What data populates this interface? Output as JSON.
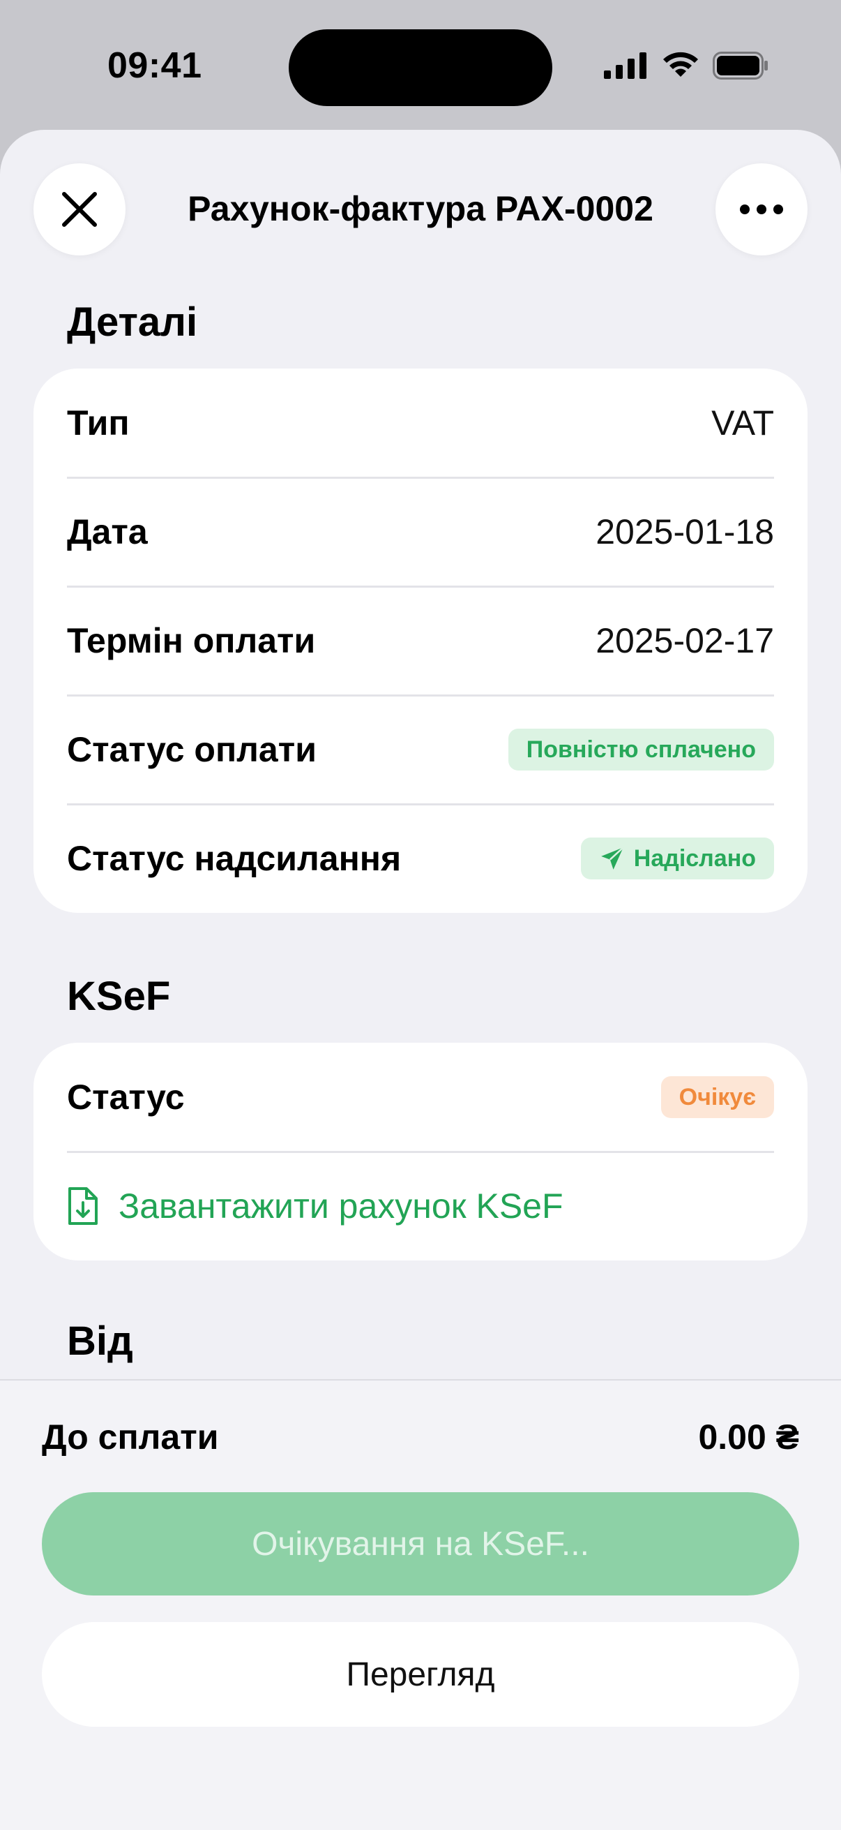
{
  "status_bar": {
    "time": "09:41"
  },
  "header": {
    "title": "Рахунок-фактура PAX-0002"
  },
  "details": {
    "section_title": "Деталі",
    "rows": [
      {
        "label": "Тип",
        "value": "VAT"
      },
      {
        "label": "Дата",
        "value": "2025-01-18"
      },
      {
        "label": "Термін оплати",
        "value": "2025-02-17"
      },
      {
        "label": "Статус оплати",
        "badge": "Повністю сплачено"
      },
      {
        "label": "Статус надсилання",
        "badge": "Надіслано"
      }
    ]
  },
  "ksef": {
    "section_title": "KSeF",
    "status_label": "Статус",
    "status_badge": "Очікує",
    "download_label": "Завантажити рахунок KSeF"
  },
  "from": {
    "section_title": "Від"
  },
  "footer": {
    "pay_label": "До сплати",
    "pay_amount": "0.00 ₴",
    "primary_button": "Очікування на KSeF...",
    "secondary_button": "Перегляд"
  },
  "colors": {
    "accent_green": "#22a455",
    "badge_green_bg": "#dcf3e3",
    "badge_orange_bg": "#fde6d6",
    "badge_orange_text": "#f08a3c",
    "primary_button_bg": "#8dd1a6"
  }
}
